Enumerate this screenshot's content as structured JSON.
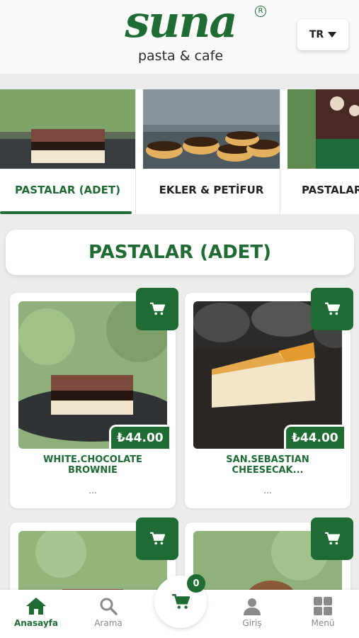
{
  "brand": {
    "name": "suna",
    "tagline": "pasta & cafe",
    "reg_mark": "R"
  },
  "language": {
    "selected": "TR"
  },
  "categories": [
    {
      "label": "PASTALAR (ADET)",
      "active": true
    },
    {
      "label": "EKLER & PETİFUR",
      "active": false
    },
    {
      "label": "PASTALAR",
      "active": false
    }
  ],
  "section": {
    "title": "PASTALAR (ADET)"
  },
  "products": [
    {
      "name": "WHITE.CHOCOLATE BROWNIE",
      "price": "₺44.00",
      "description": "..."
    },
    {
      "name": "SAN.SEBASTIAN CHEESECAK...",
      "price": "₺44.00",
      "description": "..."
    },
    {
      "name": "",
      "price": "",
      "description": ""
    },
    {
      "name": "",
      "price": "",
      "description": ""
    }
  ],
  "bottom_nav": {
    "home": "Anasayfa",
    "search": "Arama",
    "cart_count": "0",
    "login": "Giriş",
    "menu": "Menü"
  },
  "colors": {
    "brand_green": "#1e6b34",
    "muted": "#8a8a8a",
    "background": "#ececec"
  },
  "icons": [
    "home-icon",
    "search-icon",
    "cart-icon",
    "user-icon",
    "grid-icon",
    "caret-down-icon"
  ]
}
